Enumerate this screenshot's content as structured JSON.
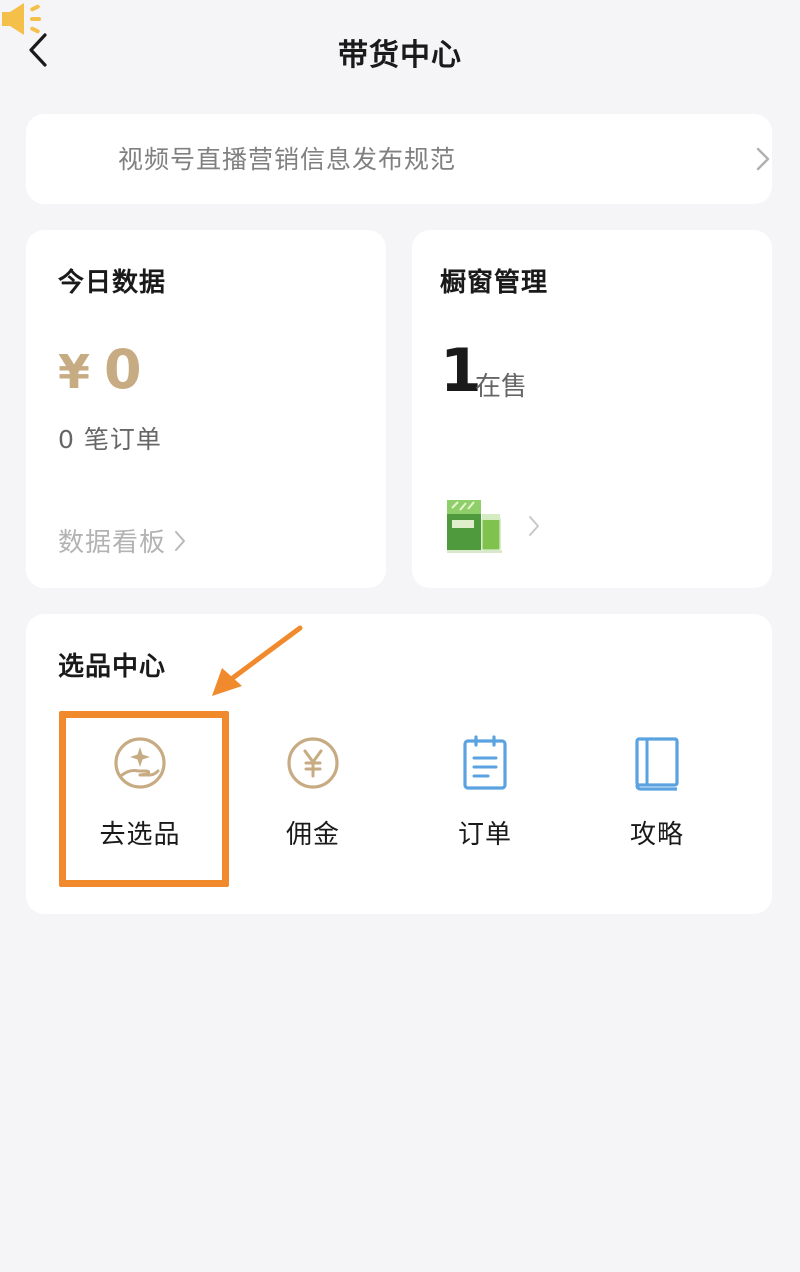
{
  "header": {
    "title": "带货中心"
  },
  "notice": {
    "text": "视频号直播营销信息发布规范"
  },
  "today": {
    "title": "今日数据",
    "currency": "¥",
    "amount": "0",
    "orders": "0 笔订单",
    "dashboard_link": "数据看板"
  },
  "window": {
    "title": "橱窗管理",
    "count": "1",
    "count_label": "在售"
  },
  "selection_center": {
    "title": "选品中心",
    "items": [
      {
        "label": "去选品",
        "icon": "sparkle-hand-icon"
      },
      {
        "label": "佣金",
        "icon": "yen-coin-icon"
      },
      {
        "label": "订单",
        "icon": "clipboard-icon"
      },
      {
        "label": "攻略",
        "icon": "book-icon"
      }
    ]
  },
  "colors": {
    "accent_gold": "#c7ab82",
    "icon_blue": "#5aa2e0",
    "highlight_orange": "#f08a2c",
    "speaker_yellow": "#f5c04a"
  }
}
